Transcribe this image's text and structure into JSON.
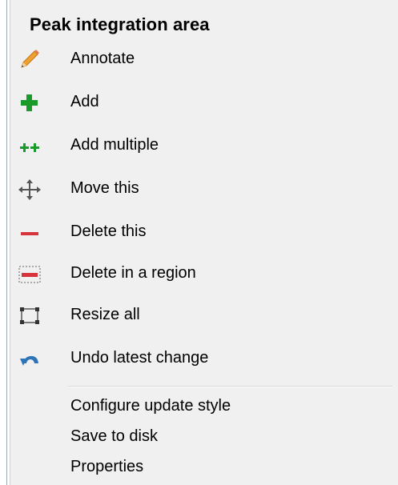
{
  "menu": {
    "title": "Peak integration area",
    "items": [
      {
        "label": "Annotate",
        "icon": "pencil-icon"
      },
      {
        "label": "Add",
        "icon": "plus-icon"
      },
      {
        "label": "Add multiple",
        "icon": "double-plus-icon"
      },
      {
        "label": "Move this",
        "icon": "move-arrows-icon"
      },
      {
        "label": "Delete this",
        "icon": "minus-icon"
      },
      {
        "label": "Delete in a region",
        "icon": "delete-region-icon"
      },
      {
        "label": "Resize all",
        "icon": "resize-corners-icon"
      },
      {
        "label": "Undo latest change",
        "icon": "undo-icon"
      }
    ],
    "secondary_items": [
      {
        "label": "Configure update style"
      },
      {
        "label": "Save to disk"
      },
      {
        "label": "Properties"
      }
    ]
  },
  "colors": {
    "menu_background": "#f0f0f0",
    "add_green": "#1a9a2a",
    "delete_red": "#d8343e",
    "pencil_orange": "#f0a030",
    "undo_blue": "#2f74b8"
  }
}
